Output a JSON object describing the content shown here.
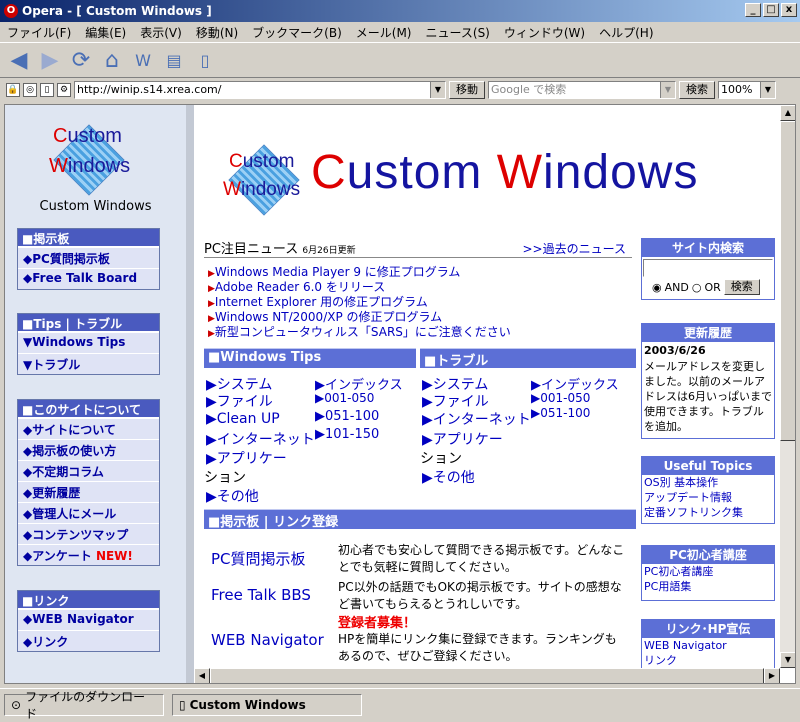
{
  "window": {
    "title": "Opera - [ Custom Windows ]",
    "min": "_",
    "restore": "□",
    "close": "x"
  },
  "menu": [
    "ファイル(F)",
    "編集(E)",
    "表示(V)",
    "移動(N)",
    "ブックマーク(B)",
    "メール(M)",
    "ニュース(S)",
    "ウィンドウ(W)",
    "ヘルプ(H)"
  ],
  "address": {
    "url": "http://winip.s14.xrea.com/",
    "go": "移動",
    "search_placeholder": "Google で検索",
    "search_btn": "検索",
    "zoom": "100%"
  },
  "side": {
    "logo": {
      "line1": "Custom",
      "line2": "Windows"
    },
    "title": "Custom Windows",
    "boxes": [
      {
        "head": "■掲示板",
        "items": [
          "◆PC質問掲示板",
          "◆Free Talk Board"
        ]
      },
      {
        "head": "■Tips | トラブル",
        "items": [
          "▼Windows Tips",
          "▼トラブル"
        ]
      },
      {
        "head": "■このサイトについて",
        "items": [
          "◆サイトについて",
          "◆掲示板の使い方",
          "◆不定期コラム",
          "◆更新履歴",
          "◆管理人にメール",
          "◆コンテンツマップ",
          "◆アンケート"
        ]
      },
      {
        "head": "■リンク",
        "items": [
          "◆WEB Navigator",
          "◆リンク"
        ]
      }
    ],
    "new_badge": "NEW!"
  },
  "main": {
    "logo": {
      "line1": "Custom",
      "line2": "Windows"
    },
    "title_c": "C",
    "title_ustom": "ustom ",
    "title_w": "W",
    "title_indows": "indows",
    "news_head": "PC注目ニュース",
    "news_date": "6月26日更新",
    "news_past": ">>過去のニュース",
    "news": [
      "Windows Media Player 9 に修正プログラム",
      "Adobe Reader 6.0 をリリース",
      "Internet Explorer 用の修正プログラム",
      "Windows NT/2000/XP の修正プログラム",
      "新型コンピュータウィルス「SARS」にご注意ください"
    ],
    "tips_head": "■Windows Tips",
    "trouble_head": "■トラブル",
    "tips_left": [
      "▶システム",
      "▶ファイル",
      "▶Clean UP",
      "▶インターネット",
      "▶アプリケー",
      "ション",
      "▶その他"
    ],
    "tips_right": [
      "▶インデックス",
      "▶001-050",
      "▶051-100",
      "▶101-150"
    ],
    "trouble_left": [
      "▶システム",
      "▶ファイル",
      "▶インターネット",
      "▶アプリケー",
      "ション",
      "▶その他"
    ],
    "trouble_right": [
      "▶インデックス",
      "▶001-050",
      "▶051-100"
    ],
    "bbs_head": "■掲示板 | リンク登録",
    "bbs": [
      {
        "name": "PC質問掲示板",
        "desc": "初心者でも安心して質問できる掲示板です。どんなことでも気軽に質問してください。"
      },
      {
        "name": "Free Talk BBS",
        "desc": "PC以外の話題でもOKの掲示板です。サイトの感想など書いてもらえるとうれしいです。"
      },
      {
        "name": "WEB Navigator",
        "notice": "登録者募集！",
        "desc": "HPを簡単にリンク集に登録できます。ランキングもあるので、ぜひご登録ください。"
      }
    ]
  },
  "right": {
    "search_head": "サイト内検索",
    "and": "AND",
    "or": "OR",
    "search_btn": "検索",
    "history_head": "更新履歴",
    "history_date": "2003/6/26",
    "history_text": "メールアドレスを変更しました。以前のメールアドレスは6月いっぱいまで使用できます。トラブルを追加。",
    "topics_head": "Useful Topics",
    "topics": [
      "OS別 基本操作",
      "アップデート情報",
      "定番ソフトリンク集"
    ],
    "beginner_head": "PC初心者講座",
    "beginner": [
      "PC初心者講座",
      "PC用語集"
    ],
    "links_head": "リンク･HP宣伝",
    "links": [
      "WEB Navigator",
      "リンク"
    ]
  },
  "status": {
    "download": "ファイルのダウンロード",
    "tab": "Custom Windows"
  }
}
